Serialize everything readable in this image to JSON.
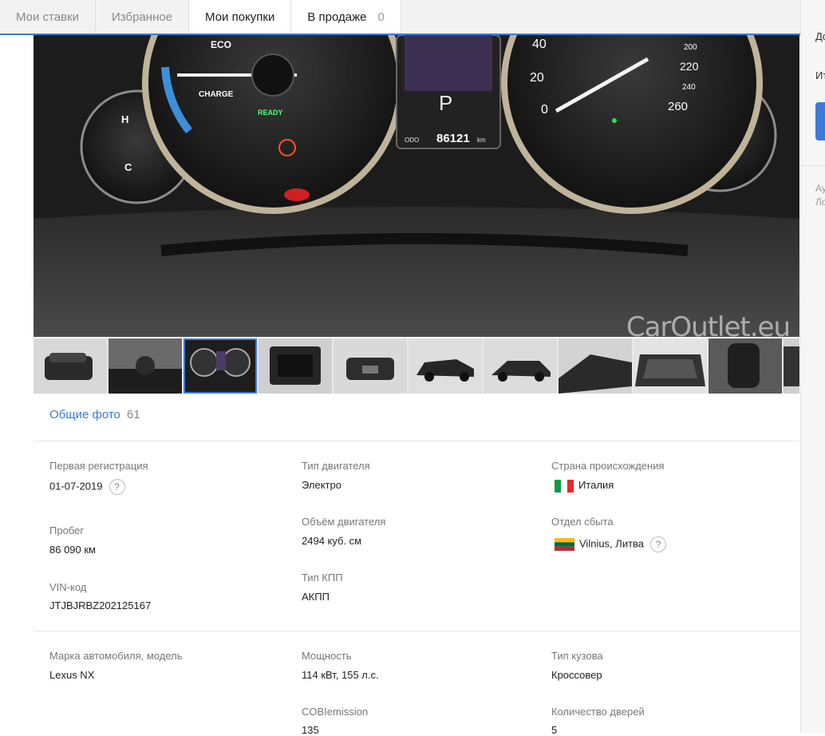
{
  "tabs": [
    {
      "label": "Мои ставки"
    },
    {
      "label": "Избранное"
    },
    {
      "label": "Мои покупки"
    },
    {
      "label": "В продаже",
      "count": "0"
    }
  ],
  "photo": {
    "watermark": "CarOutlet.eu",
    "dash": {
      "tach_labels": [
        "ECO",
        "CHARGE"
      ],
      "speed_labels": [
        "40",
        "20",
        "0",
        "200",
        "220",
        "240",
        "260"
      ],
      "temp_labels": [
        "H",
        "C"
      ],
      "ready": "READY",
      "gear": "P",
      "odo_label": "ODO",
      "odo_value": "86121",
      "odo_unit": "km"
    }
  },
  "thumbnails": [
    {
      "name": "rear-view"
    },
    {
      "name": "interior"
    },
    {
      "name": "dashboard",
      "active": true
    },
    {
      "name": "trunk"
    },
    {
      "name": "front"
    },
    {
      "name": "side"
    },
    {
      "name": "side-2"
    },
    {
      "name": "roof"
    },
    {
      "name": "windshield"
    },
    {
      "name": "seat"
    },
    {
      "name": "more"
    }
  ],
  "photos_link": {
    "label": "Общие фото",
    "count": "61"
  },
  "specs": {
    "first_registration": {
      "label": "Первая регистрация",
      "value": "01-07-2019"
    },
    "mileage": {
      "label": "Пробег",
      "value": "86 090 км"
    },
    "vin": {
      "label": "VIN-код",
      "value": "JTJBJRBZ202125167"
    },
    "engine_type": {
      "label": "Тип двигателя",
      "value": "Электро"
    },
    "engine_volume": {
      "label": "Объём двигателя",
      "value": "2494 куб. см"
    },
    "gearbox": {
      "label": "Тип КПП",
      "value": "АКПП"
    },
    "origin": {
      "label": "Страна происхождения",
      "value": "Италия"
    },
    "sales_dept": {
      "label": "Отдел сбыта",
      "value": "Vilnius, Литва"
    },
    "make_model": {
      "label": "Марка автомобиля, модель",
      "value": "Lexus NX"
    },
    "power": {
      "label": "Мощность",
      "value": "114 кВт, 155 л.с."
    },
    "co2": {
      "label": "COBIemission",
      "value": "135"
    },
    "body_type": {
      "label": "Тип кузова",
      "value": "Кроссовер"
    },
    "doors": {
      "label": "Количество дверей",
      "value": "5"
    }
  },
  "help_glyph": "?",
  "sidebar": {
    "text1": "Дс",
    "text2": "Ит",
    "text3": "Ау",
    "text4": "Ло"
  },
  "colors": {
    "accent": "#3b7ad9"
  }
}
